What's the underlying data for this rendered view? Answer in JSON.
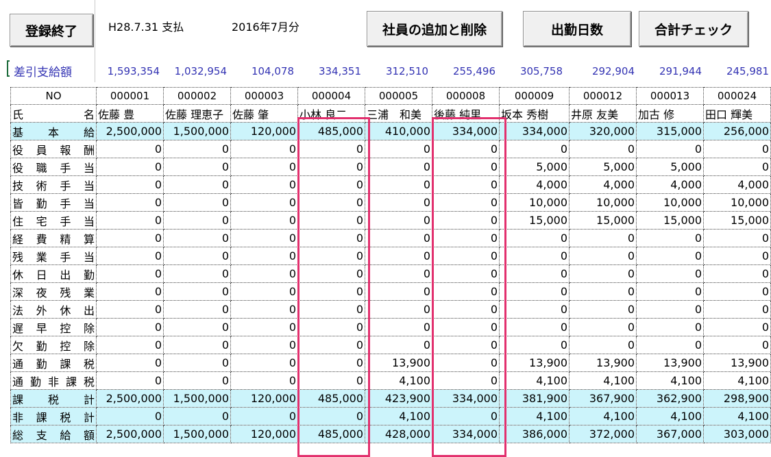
{
  "toolbar": {
    "finish_label": "登録終了",
    "add_remove_label": "社員の追加と削除",
    "work_days_label": "出勤日数",
    "total_check_label": "合計チェック"
  },
  "header": {
    "pay_date": "H28.7.31 支払",
    "period": "2016年7月分"
  },
  "net_pay": {
    "label": "差引支給額",
    "values": [
      "1,593,354",
      "1,032,954",
      "104,078",
      "334,351",
      "312,510",
      "255,496",
      "305,758",
      "292,904",
      "291,944",
      "245,981"
    ]
  },
  "table": {
    "no_label": "NO",
    "name_label_left": "氏",
    "name_label_right": "名",
    "codes": [
      "000001",
      "000002",
      "000003",
      "000004",
      "000005",
      "000008",
      "000009",
      "000012",
      "000013",
      "000024"
    ],
    "names": [
      "佐藤 豊",
      "佐藤 理恵子",
      "佐藤 肇",
      "小林 良二",
      "三浦　和美",
      "後藤 純里",
      "坂本 秀樹",
      "井原 友美",
      "加古 修",
      "田口 輝美"
    ],
    "rows": [
      {
        "label": "基　本　給",
        "values": [
          "2,500,000",
          "1,500,000",
          "120,000",
          "485,000",
          "410,000",
          "334,000",
          "334,000",
          "320,000",
          "315,000",
          "256,000"
        ]
      },
      {
        "label": "役員報酬",
        "values": [
          "0",
          "0",
          "0",
          "0",
          "0",
          "0",
          "0",
          "0",
          "0",
          "0"
        ]
      },
      {
        "label": "役職手当",
        "values": [
          "0",
          "0",
          "0",
          "0",
          "0",
          "0",
          "5,000",
          "5,000",
          "5,000",
          "0"
        ]
      },
      {
        "label": "技術手当",
        "values": [
          "0",
          "0",
          "0",
          "0",
          "0",
          "0",
          "4,000",
          "4,000",
          "4,000",
          "4,000"
        ]
      },
      {
        "label": "皆勤手当",
        "values": [
          "0",
          "0",
          "0",
          "0",
          "0",
          "0",
          "10,000",
          "10,000",
          "10,000",
          "10,000"
        ]
      },
      {
        "label": "住宅手当",
        "values": [
          "0",
          "0",
          "0",
          "0",
          "0",
          "0",
          "15,000",
          "15,000",
          "15,000",
          "15,000"
        ]
      },
      {
        "label": "経費精算",
        "values": [
          "0",
          "0",
          "0",
          "0",
          "0",
          "0",
          "0",
          "0",
          "0",
          "0"
        ]
      },
      {
        "label": "残業手当",
        "values": [
          "0",
          "0",
          "0",
          "0",
          "0",
          "0",
          "0",
          "0",
          "0",
          "0"
        ]
      },
      {
        "label": "休日出勤",
        "values": [
          "0",
          "0",
          "0",
          "0",
          "0",
          "0",
          "0",
          "0",
          "0",
          "0"
        ]
      },
      {
        "label": "深夜残業",
        "values": [
          "0",
          "0",
          "0",
          "0",
          "0",
          "0",
          "0",
          "0",
          "0",
          "0"
        ]
      },
      {
        "label": "法外休出",
        "values": [
          "0",
          "0",
          "0",
          "0",
          "0",
          "0",
          "0",
          "0",
          "0",
          "0"
        ]
      },
      {
        "label": "遅早控除",
        "values": [
          "0",
          "0",
          "0",
          "0",
          "0",
          "0",
          "0",
          "0",
          "0",
          "0"
        ]
      },
      {
        "label": "欠勤控除",
        "values": [
          "0",
          "0",
          "0",
          "0",
          "0",
          "0",
          "0",
          "0",
          "0",
          "0"
        ]
      },
      {
        "label": "通勤課税",
        "values": [
          "0",
          "0",
          "0",
          "0",
          "13,900",
          "0",
          "13,900",
          "13,900",
          "13,900",
          "13,900"
        ]
      },
      {
        "label": "通勤非課税",
        "values": [
          "0",
          "0",
          "0",
          "0",
          "4,100",
          "0",
          "4,100",
          "4,100",
          "4,100",
          "4,100"
        ]
      },
      {
        "label": "課　税　計",
        "values": [
          "2,500,000",
          "1,500,000",
          "120,000",
          "485,000",
          "423,900",
          "334,000",
          "381,900",
          "367,900",
          "362,900",
          "298,900"
        ]
      },
      {
        "label": "非課税計",
        "values": [
          "0",
          "0",
          "0",
          "0",
          "4,100",
          "0",
          "4,100",
          "4,100",
          "4,100",
          "4,100"
        ]
      },
      {
        "label": "総支給額",
        "values": [
          "2,500,000",
          "1,500,000",
          "120,000",
          "485,000",
          "428,000",
          "334,000",
          "386,000",
          "372,000",
          "367,000",
          "303,000"
        ]
      }
    ]
  },
  "colors": {
    "highlight": "#e2306e",
    "cyan_row": "#ccf4fb",
    "net_pay_text": "#3333b3"
  }
}
